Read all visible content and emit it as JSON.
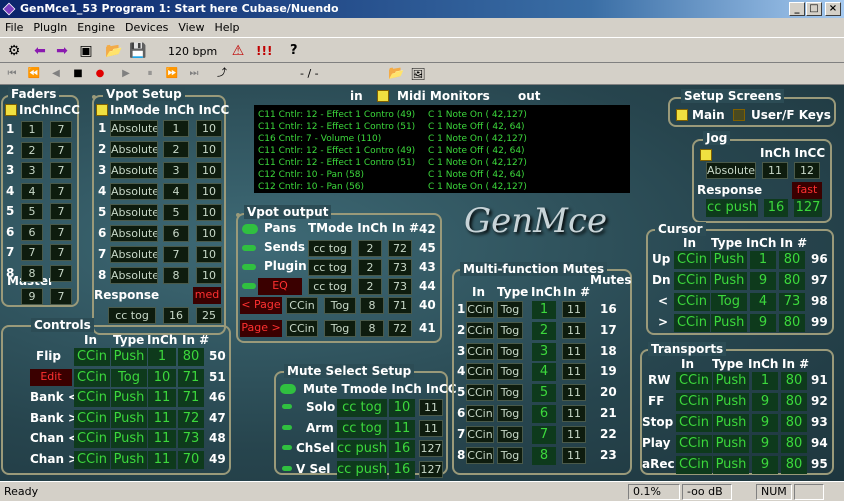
{
  "window": {
    "title": "GenMce1_53 Program 1: Start here Cubase/Nuendo"
  },
  "menu": [
    "File",
    "PlugIn",
    "Engine",
    "Devices",
    "View",
    "Help"
  ],
  "toolbar": {
    "bpm": "120 bpm",
    "exclaim": "!!!",
    "help": "?"
  },
  "transport": {
    "position": "- / -"
  },
  "monitors": {
    "in": "in",
    "title": "Midi Monitors",
    "out": "out",
    "in_lines": [
      "C11 Cntlr: 12 - Effect 1 Contro (49)",
      "C11 Cntlr: 12 - Effect 1 Contro (51)",
      "C16 Cntlr: 7 - Volume (110)",
      "C11 Cntlr: 12 - Effect 1 Contro (49)",
      "C11 Cntlr: 12 - Effect 1 Contro (51)",
      "C12 Cntlr: 10 - Pan (58)",
      "C12 Cntlr: 10 - Pan (56)"
    ],
    "out_lines": [
      "C 1 Note On  ( 42,127)",
      "C 1 Note Off ( 42, 64)",
      "C 1 Note On  ( 42,127)",
      "C 1 Note Off ( 42, 64)",
      "C 1 Note On  ( 42,127)",
      "C 1 Note Off ( 42, 64)",
      "C 1 Note On  ( 42,127)"
    ]
  },
  "logo": "GenMce",
  "faders": {
    "title": "Faders",
    "header": "InChInCC",
    "rows": [
      [
        "1",
        "1",
        "7"
      ],
      [
        "2",
        "2",
        "7"
      ],
      [
        "3",
        "3",
        "7"
      ],
      [
        "4",
        "4",
        "7"
      ],
      [
        "5",
        "5",
        "7"
      ],
      [
        "6",
        "6",
        "7"
      ],
      [
        "7",
        "7",
        "7"
      ],
      [
        "8",
        "8",
        "7"
      ]
    ],
    "master_label": "Master",
    "master": [
      "9",
      "7"
    ]
  },
  "vpot_setup": {
    "title": "Vpot Setup",
    "header": "InMode InCh  InCC",
    "rows": [
      [
        "1",
        "Absolute",
        "1",
        "10"
      ],
      [
        "2",
        "Absolute",
        "2",
        "10"
      ],
      [
        "3",
        "Absolute",
        "3",
        "10"
      ],
      [
        "4",
        "Absolute",
        "4",
        "10"
      ],
      [
        "5",
        "Absolute",
        "5",
        "10"
      ],
      [
        "6",
        "Absolute",
        "6",
        "10"
      ],
      [
        "7",
        "Absolute",
        "7",
        "10"
      ],
      [
        "8",
        "Absolute",
        "8",
        "10"
      ]
    ],
    "response_label": "Response",
    "response_badge": "med",
    "response_vals": [
      "cc tog",
      "16",
      "25"
    ]
  },
  "vpot_output": {
    "title": "Vpot output",
    "header": "TMode InCh In #",
    "rows": [
      {
        "label": "Pans",
        "vals": [
          "",
          "",
          "",
          ""
        ],
        "tail": "42"
      },
      {
        "label": "Sends",
        "vals": [
          "cc tog",
          "2",
          "72"
        ],
        "tail": "45"
      },
      {
        "label": "Plugin",
        "vals": [
          "cc tog",
          "2",
          "73"
        ],
        "tail": "43"
      },
      {
        "label": "EQ",
        "vals": [
          "cc tog",
          "2",
          "73"
        ],
        "tail": "44"
      }
    ],
    "pages": [
      {
        "label": "< Page",
        "vals": [
          "CCin",
          "Tog",
          "8",
          "71"
        ],
        "tail": "40"
      },
      {
        "label": "Page >",
        "vals": [
          "CCin",
          "Tog",
          "8",
          "72"
        ],
        "tail": "41"
      }
    ]
  },
  "controls": {
    "title": "Controls",
    "header": [
      "In",
      "Type",
      "InCh",
      "In #"
    ],
    "rows": [
      {
        "label": "Flip",
        "vals": [
          "CCin",
          "Push",
          "1",
          "80"
        ],
        "tail": "50"
      },
      {
        "label": "Edit",
        "vals": [
          "CCin",
          "Tog",
          "10",
          "71"
        ],
        "tail": "51"
      },
      {
        "label": "Bank <",
        "vals": [
          "CCin",
          "Push",
          "11",
          "71"
        ],
        "tail": "46"
      },
      {
        "label": "Bank >",
        "vals": [
          "CCin",
          "Push",
          "11",
          "72"
        ],
        "tail": "47"
      },
      {
        "label": "Chan <",
        "vals": [
          "CCin",
          "Push",
          "11",
          "73"
        ],
        "tail": "48"
      },
      {
        "label": "Chan >",
        "vals": [
          "CCin",
          "Push",
          "11",
          "70"
        ],
        "tail": "49"
      }
    ]
  },
  "mute_select": {
    "title": "Mute Select Setup",
    "header": "Mute Tmode InCh InCC",
    "rows": [
      {
        "label": "Solo",
        "vals": [
          "cc tog",
          "10",
          "11"
        ]
      },
      {
        "label": "Arm",
        "vals": [
          "cc tog",
          "11",
          "11"
        ]
      },
      {
        "label": "ChSel",
        "vals": [
          "cc push",
          "16",
          "127"
        ]
      },
      {
        "label": "V Sel",
        "vals": [
          "cc push",
          "16",
          "127"
        ]
      }
    ]
  },
  "multi_mutes": {
    "title": "Multi-function Mutes",
    "header": [
      "In",
      "Type",
      "InCh",
      "In #",
      "Mutes"
    ],
    "rows": [
      [
        "1",
        "CCin",
        "Tog",
        "1",
        "11",
        "16"
      ],
      [
        "2",
        "CCin",
        "Tog",
        "2",
        "11",
        "17"
      ],
      [
        "3",
        "CCin",
        "Tog",
        "3",
        "11",
        "18"
      ],
      [
        "4",
        "CCin",
        "Tog",
        "4",
        "11",
        "19"
      ],
      [
        "5",
        "CCin",
        "Tog",
        "5",
        "11",
        "20"
      ],
      [
        "6",
        "CCin",
        "Tog",
        "6",
        "11",
        "21"
      ],
      [
        "7",
        "CCin",
        "Tog",
        "7",
        "11",
        "22"
      ],
      [
        "8",
        "CCin",
        "Tog",
        "8",
        "11",
        "23"
      ]
    ]
  },
  "setup_screens": {
    "title": "Setup Screens",
    "main": "Main",
    "userf": "User/F Keys"
  },
  "jog": {
    "title": "Jog",
    "header": "InCh InCC",
    "vals": [
      "Absolute",
      "11",
      "12"
    ],
    "response_label": "Response",
    "response_badge": "fast",
    "response_vals": [
      "cc push",
      "16",
      "127"
    ]
  },
  "cursor": {
    "title": "Cursor",
    "header": [
      "In",
      "Type",
      "InCh",
      "In #"
    ],
    "rows": [
      {
        "label": "Up",
        "vals": [
          "CCin",
          "Push",
          "1",
          "80"
        ],
        "tail": "96"
      },
      {
        "label": "Dn",
        "vals": [
          "CCin",
          "Push",
          "9",
          "80"
        ],
        "tail": "97"
      },
      {
        "label": "<",
        "vals": [
          "CCin",
          "Tog",
          "4",
          "73"
        ],
        "tail": "98"
      },
      {
        "label": ">",
        "vals": [
          "CCin",
          "Push",
          "9",
          "80"
        ],
        "tail": "99"
      }
    ]
  },
  "transports": {
    "title": "Transports",
    "header": [
      "In",
      "Type",
      "InCh",
      "In #"
    ],
    "rows": [
      {
        "label": "RW",
        "vals": [
          "CCin",
          "Push",
          "1",
          "80"
        ],
        "tail": "91"
      },
      {
        "label": "FF",
        "vals": [
          "CCin",
          "Push",
          "9",
          "80"
        ],
        "tail": "92"
      },
      {
        "label": "Stop",
        "vals": [
          "CCin",
          "Push",
          "9",
          "80"
        ],
        "tail": "93"
      },
      {
        "label": "Play",
        "vals": [
          "CCin",
          "Push",
          "9",
          "80"
        ],
        "tail": "94"
      },
      {
        "label": "aRec",
        "vals": [
          "CCin",
          "Push",
          "9",
          "80"
        ],
        "tail": "95"
      }
    ]
  },
  "status": {
    "ready": "Ready",
    "cpu": "0.1%",
    "db": "-oo dB",
    "num": "NUM"
  }
}
